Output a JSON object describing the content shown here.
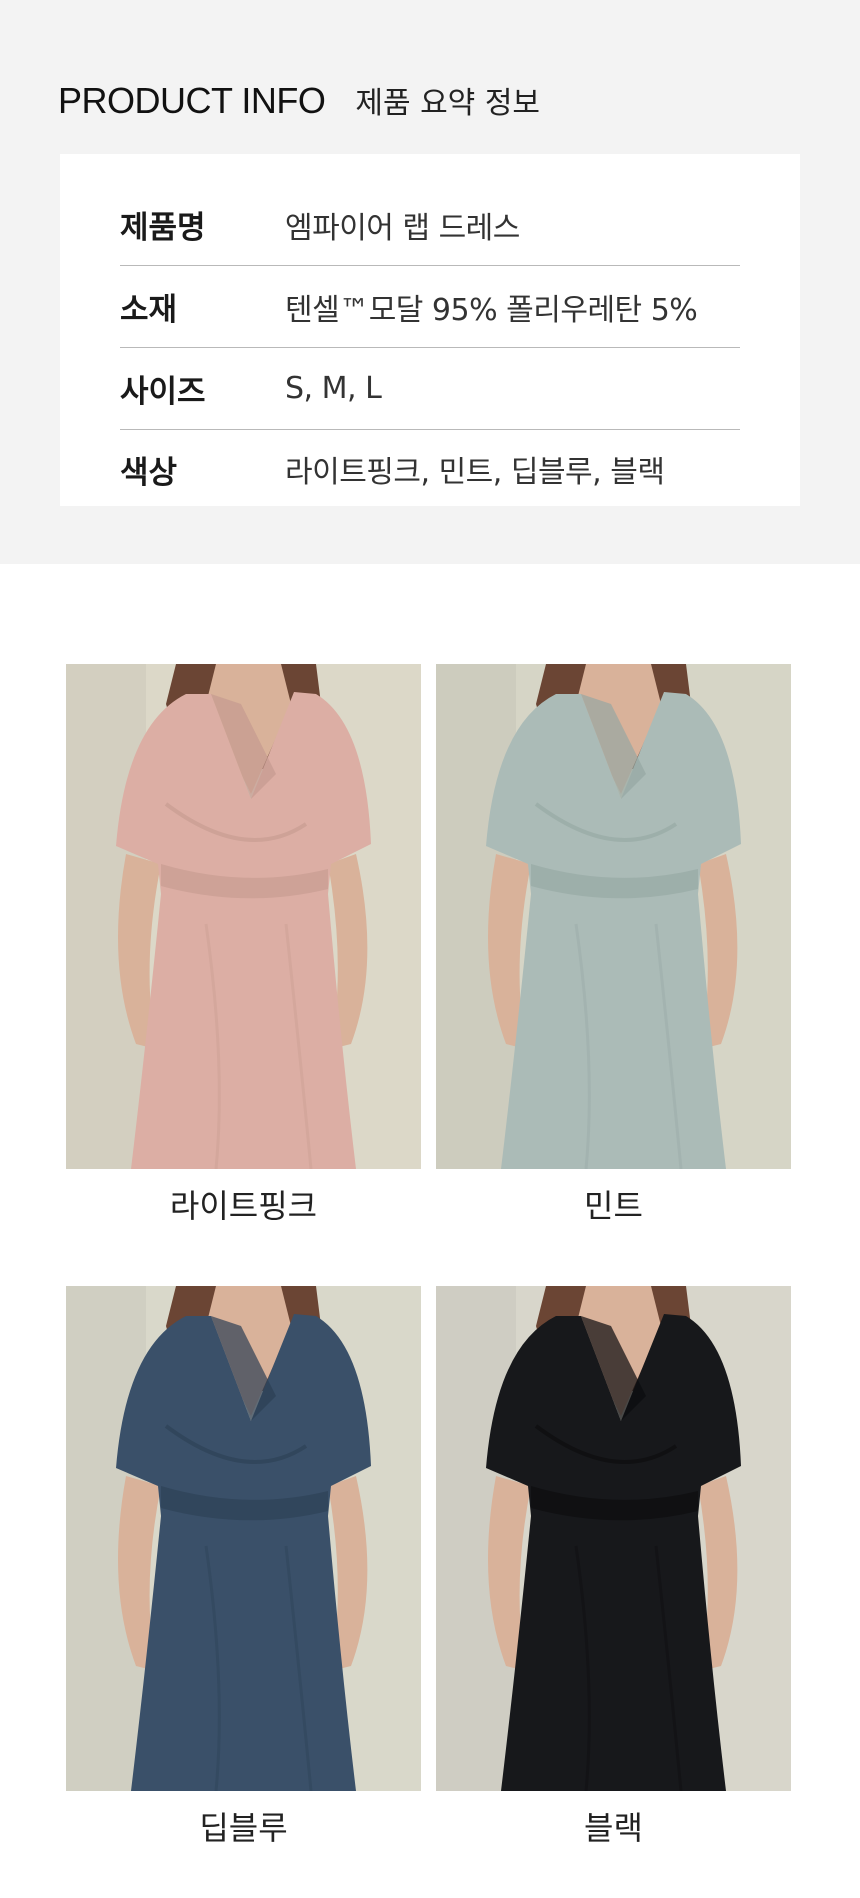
{
  "header": {
    "title": "PRODUCT INFO",
    "subtitle": "제품 요약 정보"
  },
  "info_rows": [
    {
      "label": "제품명",
      "value": "엠파이어 랩 드레스"
    },
    {
      "label": "소재",
      "value": "텐셀™모달 95% 폴리우레탄 5%"
    },
    {
      "label": "사이즈",
      "value": "S, M, L"
    },
    {
      "label": "색상",
      "value": "라이트핑크, 민트, 딥블루, 블랙"
    }
  ],
  "colors": [
    {
      "name": "라이트핑크",
      "dress": "#dcaea4",
      "dress_shade": "#c59a90",
      "bg": "#dcd8c8",
      "icon": "dress-photo-icon"
    },
    {
      "name": "민트",
      "dress": "#abbbb7",
      "dress_shade": "#95a6a2",
      "bg": "#d6d5c6",
      "icon": "dress-photo-icon"
    },
    {
      "name": "딥블루",
      "dress": "#3a5069",
      "dress_shade": "#2c3f54",
      "bg": "#d9d8ca",
      "icon": "dress-photo-icon"
    },
    {
      "name": "블랙",
      "dress": "#17181b",
      "dress_shade": "#0c0c0e",
      "bg": "#d8d6cb",
      "icon": "dress-photo-icon"
    }
  ]
}
